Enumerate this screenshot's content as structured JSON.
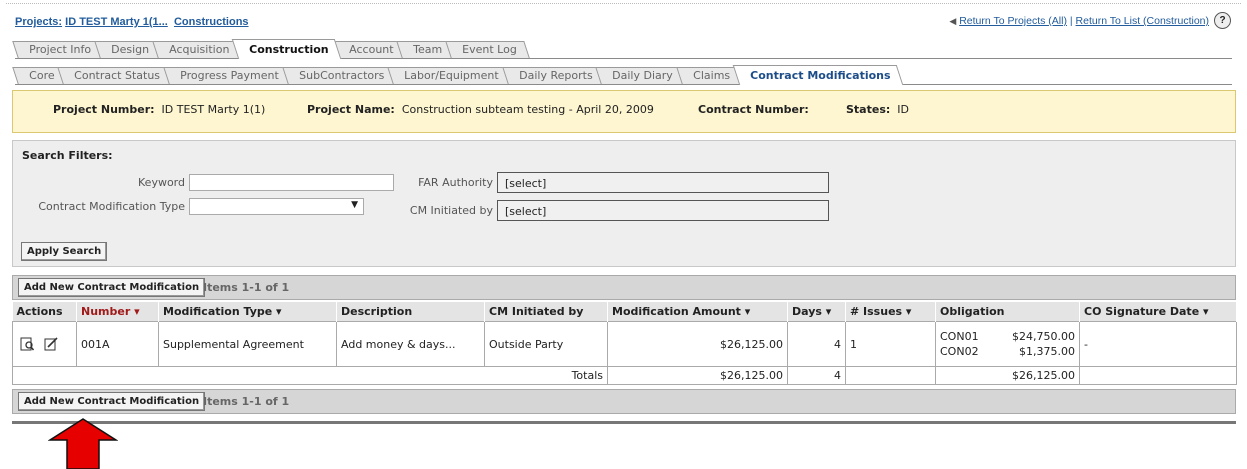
{
  "breadcrumb": {
    "prefix": "Projects:",
    "project": "ID TEST Marty 1(1...",
    "section": "Constructions"
  },
  "toplinks": {
    "return_projects": "Return To Projects (All)",
    "sep": "|",
    "return_list": "Return To List (Construction)",
    "help": "?"
  },
  "main_tabs": [
    "Project Info",
    "Design",
    "Acquisition",
    "Construction",
    "Account",
    "Team",
    "Event Log"
  ],
  "sub_tabs": [
    "Core",
    "Contract Status",
    "Progress Payment",
    "SubContractors",
    "Labor/Equipment",
    "Daily Reports",
    "Daily Diary",
    "Claims",
    "Contract Modifications"
  ],
  "info": {
    "project_number_label": "Project Number:",
    "project_number": "ID TEST Marty 1(1)",
    "project_name_label": "Project Name:",
    "project_name": "Construction subteam testing - April 20, 2009",
    "contract_number_label": "Contract Number:",
    "contract_number": "",
    "states_label": "States:",
    "states": "ID"
  },
  "search": {
    "title": "Search Filters:",
    "keyword_label": "Keyword",
    "keyword_value": "",
    "cmt_label": "Contract Modification Type",
    "cmt_value": "",
    "far_label": "FAR Authority",
    "far_value": "[select]",
    "cm_label": "CM Initiated by",
    "cm_value": "[select]",
    "apply": "Apply Search"
  },
  "toolbar": {
    "add_button": "Add New Contract Modification",
    "items": "Items 1-1 of 1"
  },
  "table": {
    "headers": [
      "Actions",
      "Number ▾",
      "Modification Type ▾",
      "Description",
      "CM Initiated by",
      "Modification Amount ▾",
      "Days ▾",
      "# Issues ▾",
      "Obligation",
      "CO Signature Date ▾"
    ],
    "row": {
      "number": "001A",
      "type": "Supplemental Agreement",
      "description": "Add money & days...",
      "cm_initiated": "Outside Party",
      "amount": "$26,125.00",
      "days": "4",
      "issues": "1",
      "obligations": [
        {
          "code": "CON01",
          "amount": "$24,750.00"
        },
        {
          "code": "CON02",
          "amount": "$1,375.00"
        }
      ],
      "co_signature": "-"
    },
    "totals": {
      "label": "Totals",
      "amount": "$26,125.00",
      "days": "4",
      "obligation": "$26,125.00"
    }
  },
  "colors": {
    "link": "#225c9c",
    "arrow": "#e60000",
    "infobar": "#fdf6d0"
  }
}
